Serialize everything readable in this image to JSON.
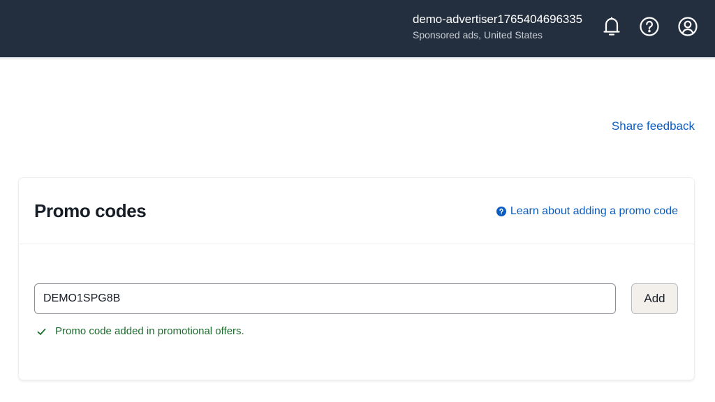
{
  "header": {
    "account_name": "demo-advertiser1765404696335",
    "account_sub": "Sponsored ads, United States",
    "icons": [
      "bell-icon",
      "help-icon",
      "user-icon"
    ]
  },
  "share_feedback": "Share feedback",
  "promo": {
    "title": "Promo codes",
    "learn_link": "Learn about adding a promo code",
    "input_value": "DEMO1SPG8B",
    "add_label": "Add",
    "success_message": "Promo code added in promotional offers."
  },
  "colors": {
    "topbar": "#232f3e",
    "link": "#0b5cc1",
    "success": "#1d6b2e",
    "button_bg": "#f3f0ec"
  }
}
